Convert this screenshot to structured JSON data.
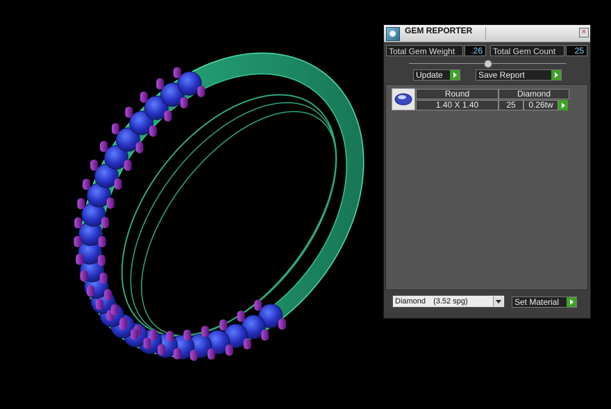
{
  "panel": {
    "title": "GEM REPORTER",
    "close_label": "×",
    "total_gem_weight_label": "Total Gem Weight",
    "total_gem_weight_value": ".26",
    "total_gem_count_label": "Total Gem Count",
    "total_gem_count_value": "25",
    "update_label": "Update",
    "save_report_label": "Save Report",
    "table": {
      "headers": [
        "Round",
        "Diamond"
      ],
      "rows": [
        {
          "size": "1.40 X 1.40",
          "count": "25",
          "weight": "0.26tw"
        }
      ]
    },
    "material_select": {
      "selected_name": "Diamond",
      "selected_spg": "(3.52 spg)"
    },
    "set_material_label": "Set Material"
  },
  "colors": {
    "ring_metal": "#22a47a",
    "gem": "#2532c8",
    "prong": "#8a2bb0",
    "panel_bg": "#3d3d3d",
    "value_text": "#7fd0ff",
    "arrow_green": "#3fa12a"
  },
  "icons": {
    "title": "gem-reporter-icon",
    "close": "close-icon",
    "slider": "slider-knob-icon",
    "action": "green-arrow-icon",
    "thumb": "round-gem-icon",
    "dropdown": "chevron-down-icon"
  }
}
